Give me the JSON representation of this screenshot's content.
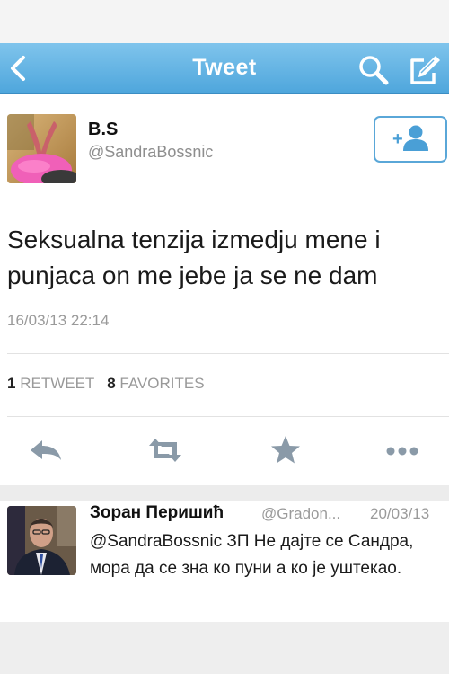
{
  "navbar": {
    "title": "Tweet",
    "color": "#55aadf"
  },
  "tweet": {
    "name": "B.S",
    "handle": "@SandraBossnic",
    "text": "Seksualna tenzija izmedju mene i punjaca on me jebe ja se ne dam",
    "timestamp": "16/03/13 22:14",
    "retweet_count": "1",
    "retweet_label": "RETWEET",
    "favorite_count": "8",
    "favorite_label": "FAVORITES",
    "follow_icon": "add-user-icon"
  },
  "actions": [
    "reply-icon",
    "retweet-icon",
    "favorite-icon",
    "more-icon"
  ],
  "reply": {
    "name": "Зоран Перишић",
    "handle": "@Gradon...",
    "date": "20/03/13",
    "text": "@SandraBossnic ЗП Не дајте се Сандра, мора да се зна ко пуни а ко је уштекао."
  }
}
